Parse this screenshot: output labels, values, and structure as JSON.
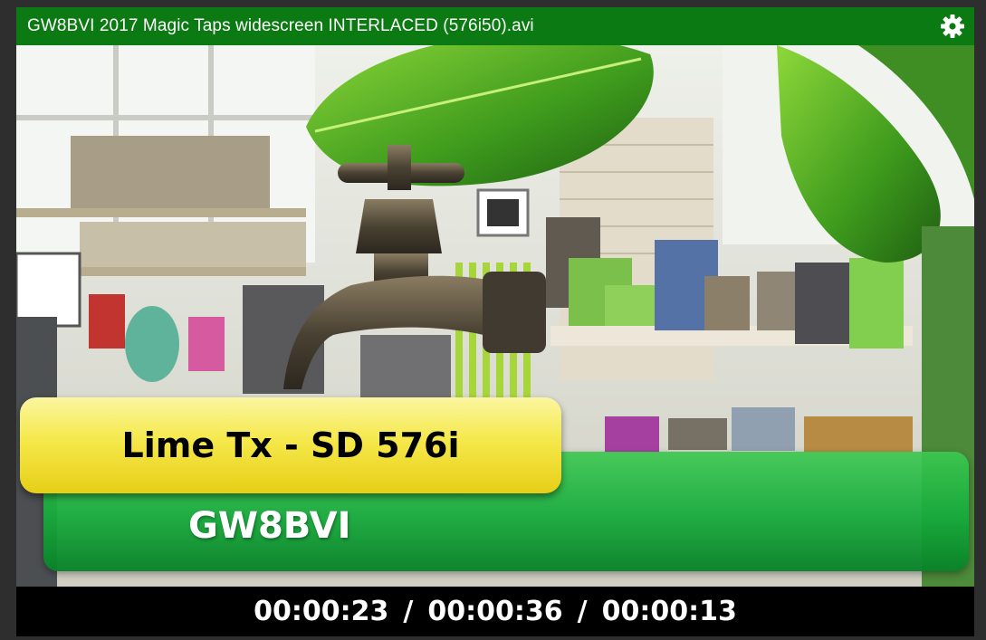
{
  "window": {
    "title": "GW8BVI 2017 Magic Taps widescreen INTERLACED (576i50).avi",
    "settings_icon": "gear-icon"
  },
  "overlay": {
    "lower_third_top": "Lime Tx - SD 576i",
    "lower_third_bottom": "GW8BVI"
  },
  "status": {
    "time_elapsed": "00:00:23",
    "time_total": "00:00:36",
    "time_remaining": "00:00:13",
    "separator": "/"
  },
  "colors": {
    "titlebar": "#0b7a12",
    "lower_third_green": "#16aa3c",
    "lower_third_yellow": "#f5e84a",
    "statusbar": "#000000"
  }
}
